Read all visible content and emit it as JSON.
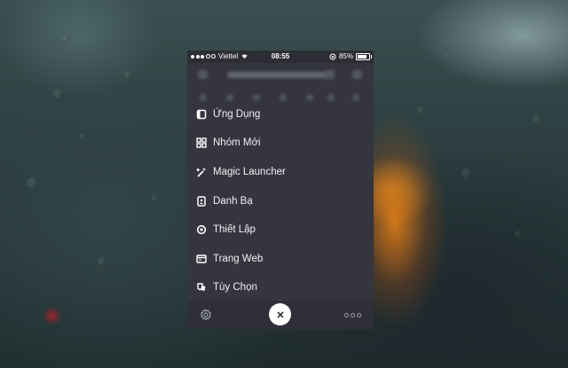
{
  "status_bar": {
    "carrier": "Viettel",
    "time": "08:55",
    "battery": "85%"
  },
  "menu": {
    "items": [
      {
        "label": "Ứng Dụng",
        "icon": "apps-icon"
      },
      {
        "label": "Nhóm Mới",
        "icon": "grid-icon"
      },
      {
        "label": "Magic Launcher",
        "icon": "magic-wand-icon"
      },
      {
        "label": "Danh Bạ",
        "icon": "contacts-icon"
      },
      {
        "label": "Thiết Lập",
        "icon": "settings-ring-icon"
      },
      {
        "label": "Trang Web",
        "icon": "browser-icon"
      },
      {
        "label": "Tùy Chọn",
        "icon": "options-icon"
      }
    ]
  },
  "toolbar": {
    "left_icon": "gear-icon",
    "center_icon": "close-icon",
    "right_icon": "more-icon"
  },
  "colors": {
    "panel_bg": "#34353f",
    "status_bg": "#2c2d35",
    "bottom_bg": "#2e2f38",
    "text": "#f1f1f3"
  }
}
